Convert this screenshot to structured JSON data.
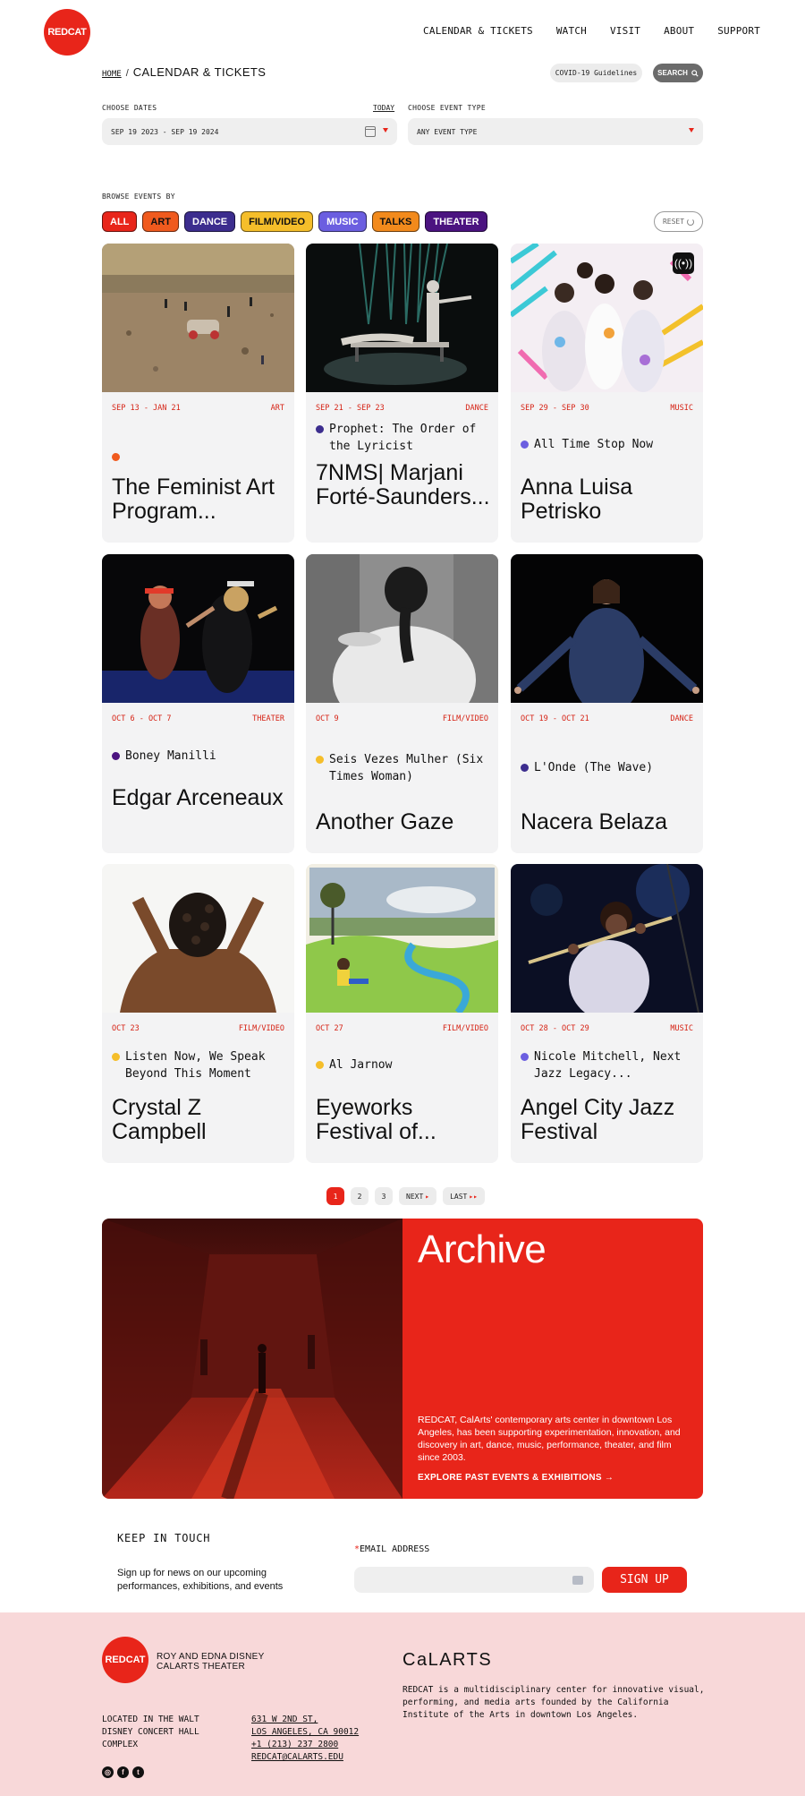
{
  "header": {
    "logo": "REDCAT",
    "nav": [
      "CALENDAR & TICKETS",
      "WATCH",
      "VISIT",
      "ABOUT",
      "SUPPORT"
    ]
  },
  "breadcrumb": {
    "home": "HOME",
    "separator": "/",
    "current": "CALENDAR & TICKETS"
  },
  "toolbar": {
    "covid": "COVID-19 Guidelines",
    "search": "SEARCH"
  },
  "filters": {
    "dates_label": "CHOOSE DATES",
    "today": "TODAY",
    "dates_value": "SEP 19 2023 - SEP 19 2024",
    "type_label": "CHOOSE EVENT TYPE",
    "type_value": "ANY EVENT TYPE"
  },
  "browse": {
    "label": "BROWSE EVENTS BY",
    "reset": "RESET",
    "chips": [
      {
        "label": "ALL",
        "color": "#e8251a",
        "text": "#ffffff"
      },
      {
        "label": "ART",
        "color": "#f05a1e",
        "text": "#111111"
      },
      {
        "label": "DANCE",
        "color": "#3c2d8e",
        "text": "#ffffff"
      },
      {
        "label": "FILM/VIDEO",
        "color": "#f5be2a",
        "text": "#111111"
      },
      {
        "label": "MUSIC",
        "color": "#6b5ee0",
        "text": "#ffffff"
      },
      {
        "label": "TALKS",
        "color": "#f28a1c",
        "text": "#111111"
      },
      {
        "label": "THEATER",
        "color": "#4b1380",
        "text": "#ffffff"
      }
    ]
  },
  "events": [
    {
      "dates": "SEP 13 - JAN 21",
      "genre": "ART",
      "subtitle": "",
      "dot": "#f05a1e",
      "title": "The Feminist Art Program...",
      "image": "desert-car-scene"
    },
    {
      "dates": "SEP 21 - SEP 23",
      "genre": "DANCE",
      "subtitle": "Prophet: The Order of the Lyricist",
      "dot": "#3c2d8e",
      "title": "7NMS| Marjani Forté-Saunders...",
      "image": "dance-stage"
    },
    {
      "dates": "SEP 29 - SEP 30",
      "genre": "MUSIC",
      "subtitle": "All Time Stop Now",
      "dot": "#6b5ee0",
      "title": "Anna Luisa Petrisko",
      "image": "colorful-costumes",
      "badge": "live-stream-icon"
    },
    {
      "dates": "OCT 6 - OCT 7",
      "genre": "THEATER",
      "subtitle": "Boney Manilli",
      "dot": "#4b1380",
      "title": "Edgar Arceneaux",
      "image": "theater-scene"
    },
    {
      "dates": "OCT 9",
      "genre": "FILM/VIDEO",
      "subtitle": "Seis Vezes Mulher (Six Times Woman)",
      "dot": "#f5be2a",
      "title": "Another Gaze",
      "image": "bw-braid"
    },
    {
      "dates": "OCT 19 - OCT 21",
      "genre": "DANCE",
      "subtitle": "L'Onde (The Wave)",
      "dot": "#3c2d8e",
      "title": "Nacera Belaza",
      "image": "dancer-dark"
    },
    {
      "dates": "OCT 23",
      "genre": "FILM/VIDEO",
      "subtitle": "Listen Now, We Speak Beyond This Moment",
      "dot": "#f5be2a",
      "title": "Crystal Z Campbell",
      "image": "hair-back"
    },
    {
      "dates": "OCT 27",
      "genre": "FILM/VIDEO",
      "subtitle": "Al Jarnow",
      "dot": "#f5be2a",
      "title": "Eyeworks Festival of...",
      "image": "animated-landscape"
    },
    {
      "dates": "OCT 28 - OCT 29",
      "genre": "MUSIC",
      "subtitle": "Nicole Mitchell, Next Jazz Legacy...",
      "dot": "#6b5ee0",
      "title": "Angel City Jazz Festival",
      "image": "flute-player"
    }
  ],
  "pagination": {
    "pages": [
      "1",
      "2",
      "3"
    ],
    "next": "NEXT",
    "last": "LAST",
    "current": "1"
  },
  "archive": {
    "title": "Archive",
    "text": "REDCAT, CalArts' contemporary arts center in downtown Los Angeles, has been supporting experimentation, innovation, and discovery in art, dance, music, performance, theater, and film since 2003.",
    "link": "EXPLORE PAST EVENTS & EXHIBITIONS →"
  },
  "newsletter": {
    "title": "KEEP IN TOUCH",
    "desc": "Sign up for news on our upcoming performances, exhibitions, and events",
    "required": "*",
    "email_label": "EMAIL ADDRESS",
    "signup": "SIGN UP"
  },
  "footer": {
    "logo": "REDCAT",
    "theater_line1": "ROY AND EDNA DISNEY",
    "theater_line2": "CALARTS THEATER",
    "calarts": "CaLARTS",
    "about": "REDCAT is a multidisciplinary center for innovative visual, performing, and media arts founded by the California Institute of the Arts in downtown Los Angeles.",
    "location": "LOCATED IN THE WALT DISNEY CONCERT HALL COMPLEX",
    "address1": "631 W 2ND ST,",
    "address2": "LOS ANGELES, CA 90012",
    "phone": "+1 (213) 237 2800",
    "email": "REDCAT@CALARTS.EDU",
    "social": [
      "instagram-icon",
      "facebook-icon",
      "twitter-icon"
    ]
  }
}
